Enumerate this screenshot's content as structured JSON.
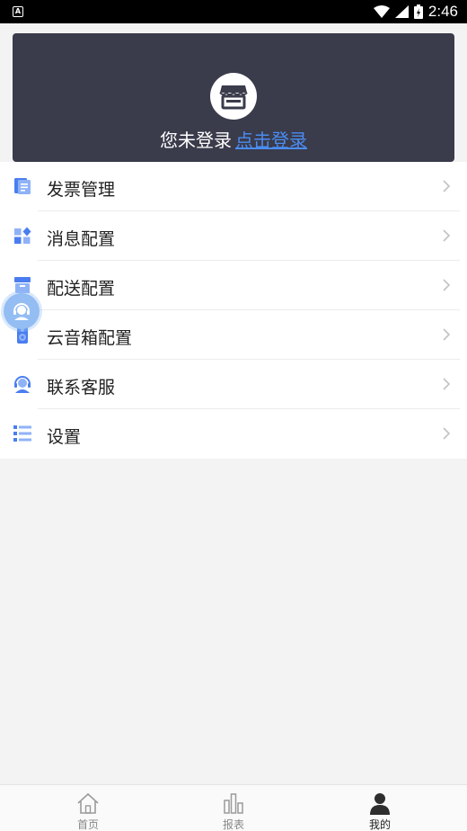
{
  "status_bar": {
    "badge": "A",
    "time": "2:46"
  },
  "header": {
    "status_text": "您未登录",
    "login_link": "点击登录"
  },
  "menu": {
    "items": [
      {
        "label": "发票管理",
        "icon": "invoice-icon"
      },
      {
        "label": "消息配置",
        "icon": "grid-diamond-icon"
      },
      {
        "label": "配送配置",
        "icon": "delivery-box-icon"
      },
      {
        "label": "云音箱配置",
        "icon": "speaker-icon"
      },
      {
        "label": "联系客服",
        "icon": "customer-service-icon"
      },
      {
        "label": "设置",
        "icon": "list-icon"
      }
    ]
  },
  "bottom_nav": {
    "items": [
      {
        "label": "首页",
        "icon": "home-icon"
      },
      {
        "label": "报表",
        "icon": "bar-chart-icon"
      },
      {
        "label": "我的",
        "icon": "user-icon",
        "active": true
      }
    ]
  },
  "colors": {
    "header_bg": "#3a3b4b",
    "accent": "#4a8cf0",
    "icon_blue": "#5b8ef5"
  }
}
